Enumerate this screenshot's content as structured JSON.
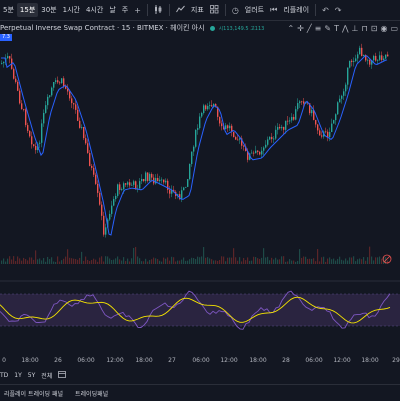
{
  "toolbar": {
    "timeframes": [
      "5분",
      "15분",
      "30분",
      "1시간",
      "4시간",
      "날",
      "주"
    ],
    "active_timeframe": "15분",
    "indicators_label": "지표",
    "alert_label": "얼러트",
    "replay_label": "리플레이"
  },
  "symbol": {
    "title": "Perpetual Inverse Swap Contract · 15 · BITMEX · 헤이킨 아시",
    "ohlc": "시113,149.5 고113",
    "status_color": "#26a69a"
  },
  "ma_tag": "7.3",
  "colors": {
    "background": "#131722",
    "up": "#26a69a",
    "down": "#ef5350",
    "ma": "#2962ff",
    "osc_fast": "#7e57c2",
    "osc_slow": "#f5e400",
    "osc_band": "#2a2440"
  },
  "time_axis": {
    "ticks": [
      "0",
      "18:00",
      "26",
      "06:00",
      "12:00",
      "18:00",
      "27",
      "06:00",
      "12:00",
      "18:00",
      "28",
      "06:00",
      "12:00",
      "18:00",
      "29"
    ]
  },
  "range": {
    "buttons": [
      "TD",
      "1Y",
      "5Y",
      "전체"
    ],
    "calendar_icon": "calendar-range-icon"
  },
  "bottom_tabs": [
    "리플레이 트레이딩 패널",
    "트레이딩패널"
  ],
  "icons": [
    "plus-icon",
    "candles-icon",
    "indicator-icon",
    "grid-icon",
    "alert-clock-icon",
    "replay-icon",
    "undo-icon",
    "redo-icon",
    "collapse-icon",
    "drawing-tool-icons",
    "gear-icon"
  ]
}
